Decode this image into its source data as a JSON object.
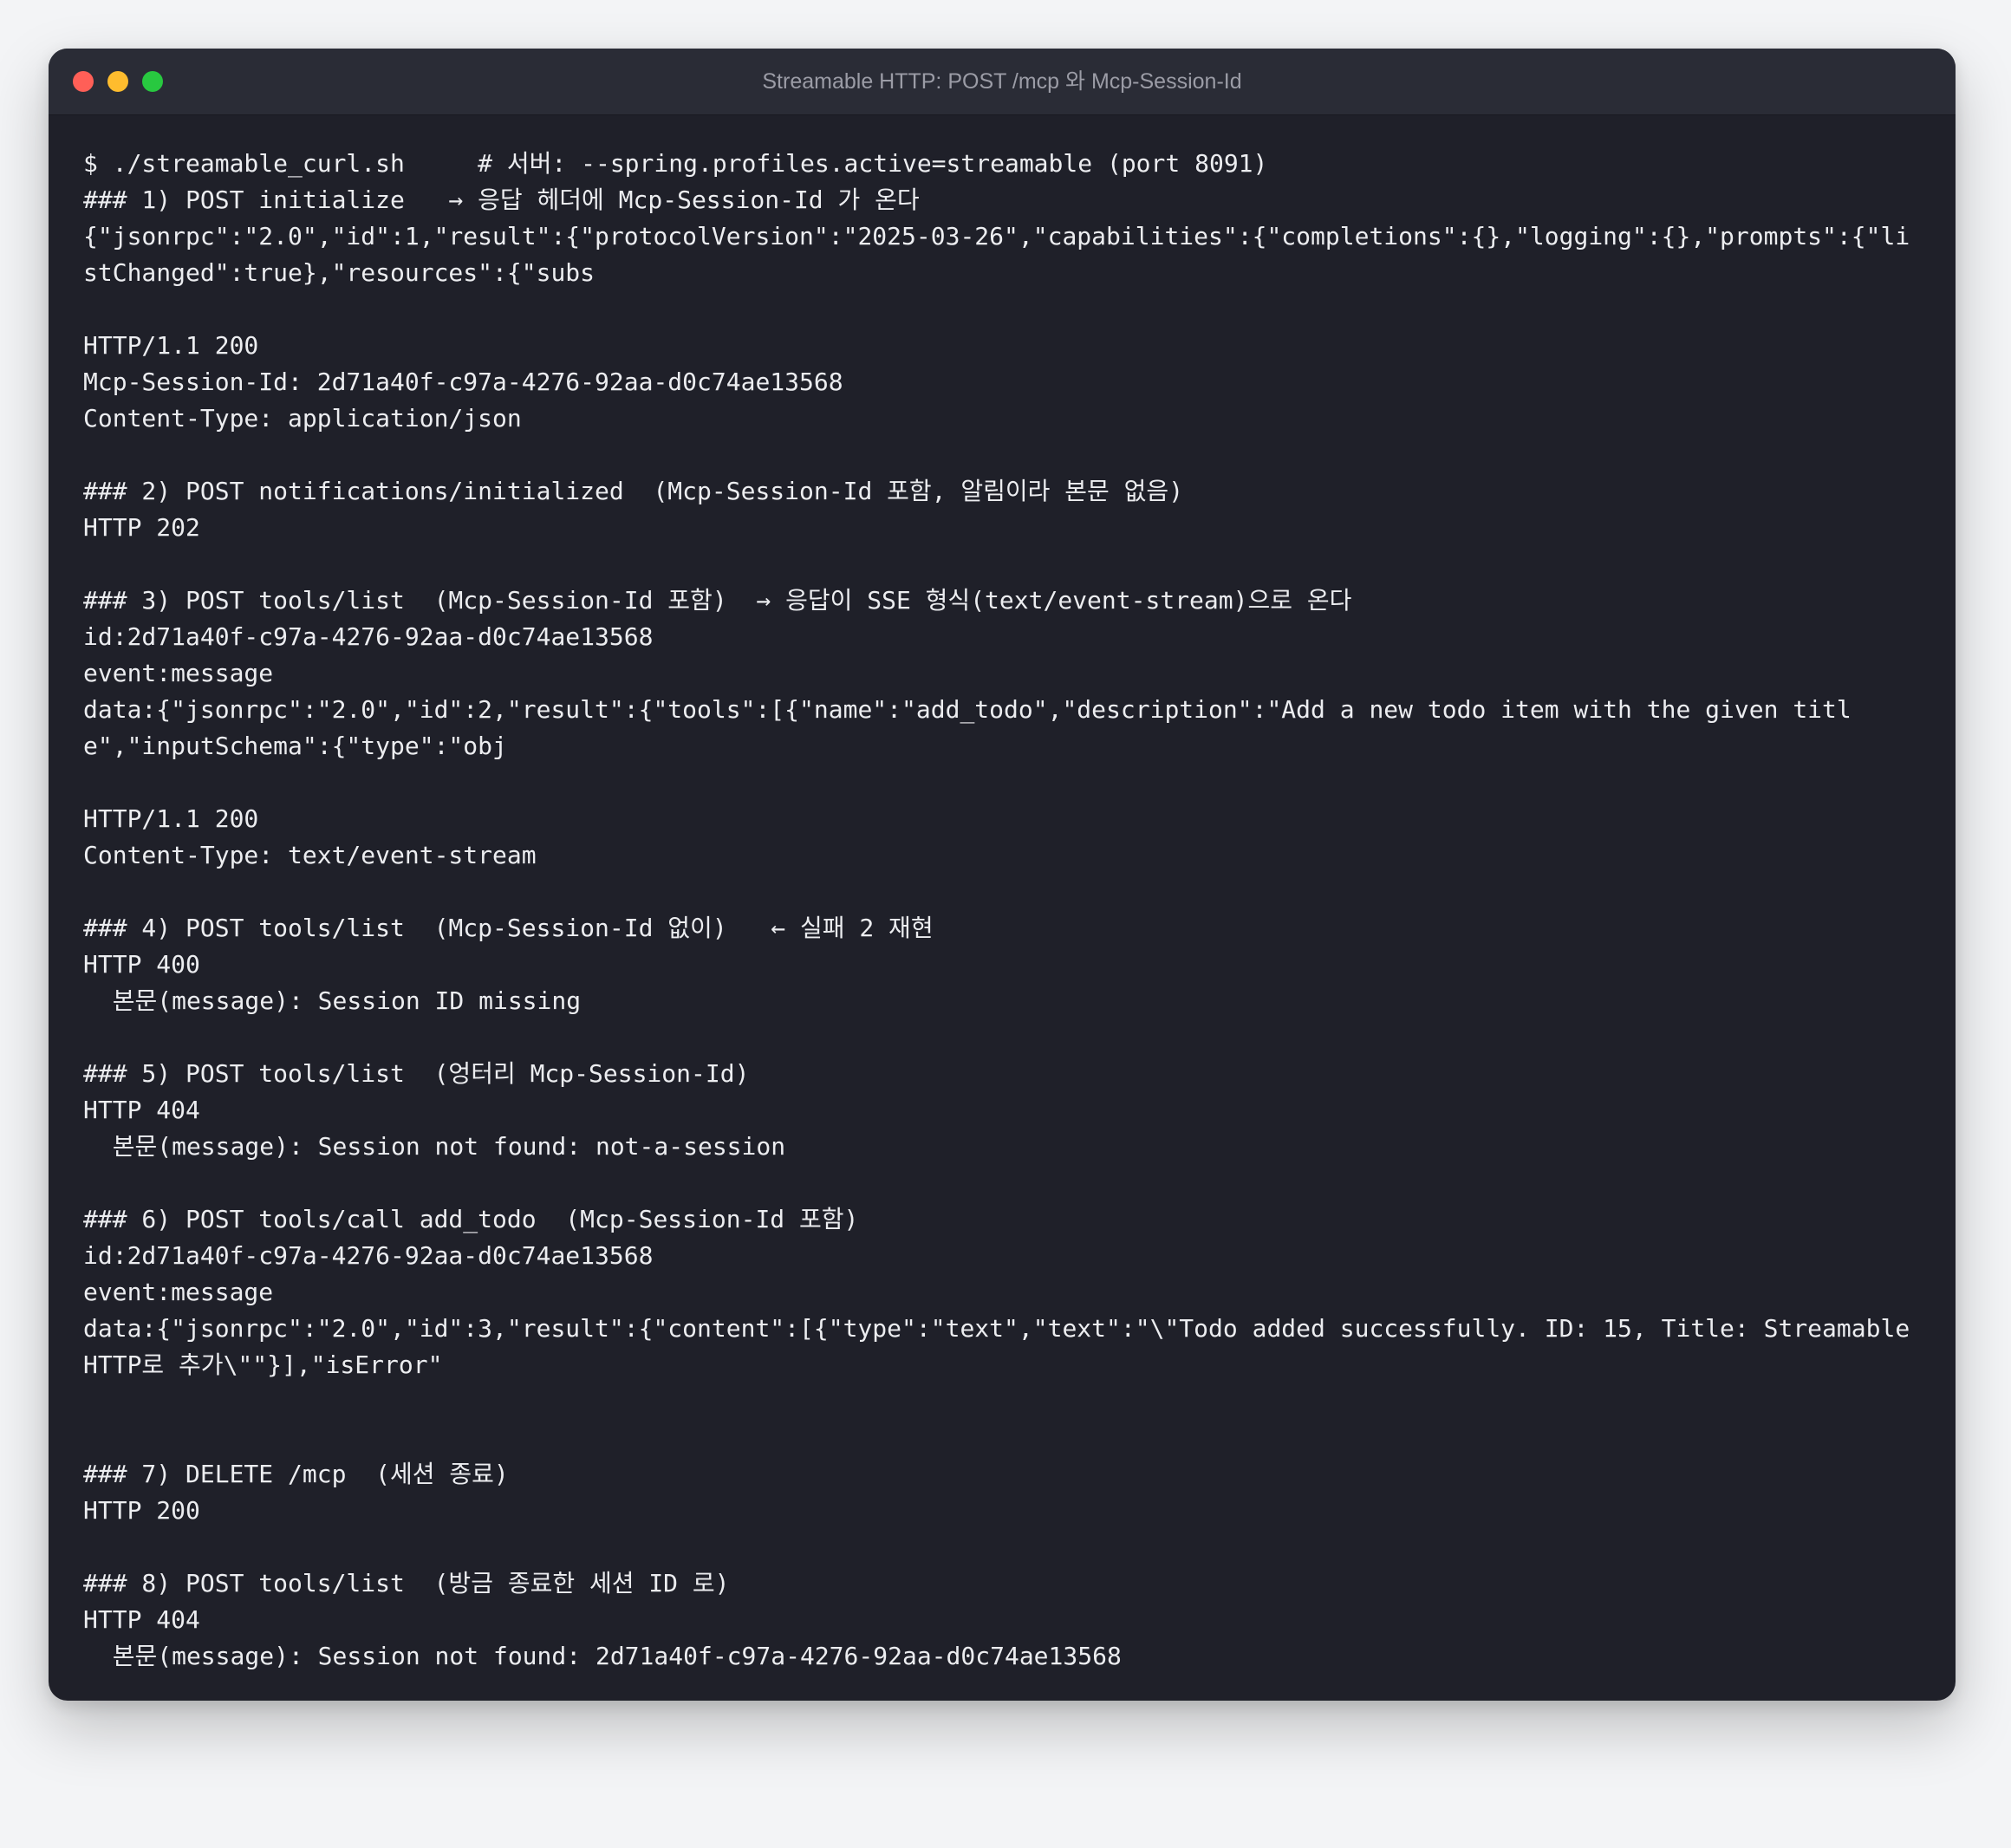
{
  "window": {
    "title": "Streamable HTTP: POST /mcp 와 Mcp-Session-Id"
  },
  "terminal": {
    "lines": [
      "$ ./streamable_curl.sh     # 서버: --spring.profiles.active=streamable (port 8091)",
      "### 1) POST initialize   → 응답 헤더에 Mcp-Session-Id 가 온다",
      "{\"jsonrpc\":\"2.0\",\"id\":1,\"result\":{\"protocolVersion\":\"2025-03-26\",\"capabilities\":{\"completions\":{},\"logging\":{},\"prompts\":{\"listChanged\":true},\"resources\":{\"subs",
      "",
      "HTTP/1.1 200",
      "Mcp-Session-Id: 2d71a40f-c97a-4276-92aa-d0c74ae13568",
      "Content-Type: application/json",
      "",
      "### 2) POST notifications/initialized  (Mcp-Session-Id 포함, 알림이라 본문 없음)",
      "HTTP 202",
      "",
      "### 3) POST tools/list  (Mcp-Session-Id 포함)  → 응답이 SSE 형식(text/event-stream)으로 온다",
      "id:2d71a40f-c97a-4276-92aa-d0c74ae13568",
      "event:message",
      "data:{\"jsonrpc\":\"2.0\",\"id\":2,\"result\":{\"tools\":[{\"name\":\"add_todo\",\"description\":\"Add a new todo item with the given title\",\"inputSchema\":{\"type\":\"obj",
      "",
      "HTTP/1.1 200",
      "Content-Type: text/event-stream",
      "",
      "### 4) POST tools/list  (Mcp-Session-Id 없이)   ← 실패 2 재현",
      "HTTP 400",
      "  본문(message): Session ID missing",
      "",
      "### 5) POST tools/list  (엉터리 Mcp-Session-Id)",
      "HTTP 404",
      "  본문(message): Session not found: not-a-session",
      "",
      "### 6) POST tools/call add_todo  (Mcp-Session-Id 포함)",
      "id:2d71a40f-c97a-4276-92aa-d0c74ae13568",
      "event:message",
      "data:{\"jsonrpc\":\"2.0\",\"id\":3,\"result\":{\"content\":[{\"type\":\"text\",\"text\":\"\\\"Todo added successfully. ID: 15, Title: Streamable HTTP로 추가\\\"\"}],\"isError\"",
      "",
      "",
      "### 7) DELETE /mcp  (세션 종료)",
      "HTTP 200",
      "",
      "### 8) POST tools/list  (방금 종료한 세션 ID 로)",
      "HTTP 404",
      "  본문(message): Session not found: 2d71a40f-c97a-4276-92aa-d0c74ae13568"
    ]
  }
}
